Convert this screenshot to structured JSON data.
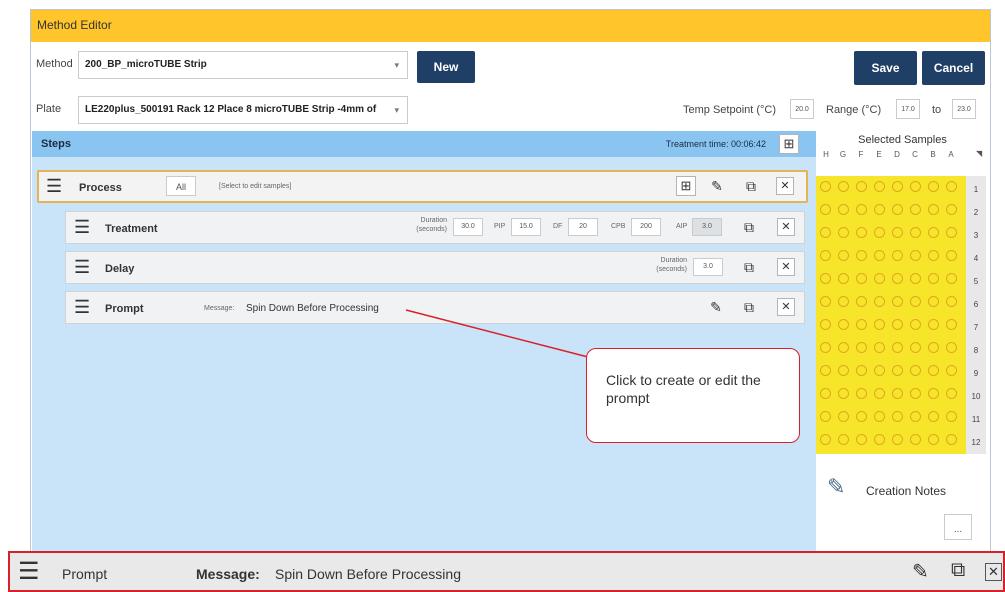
{
  "window": {
    "title": "Method Editor"
  },
  "method": {
    "label": "Method",
    "value": "200_BP_microTUBE Strip",
    "new_label": "New"
  },
  "actions": {
    "save_label": "Save",
    "cancel_label": "Cancel"
  },
  "plate": {
    "label": "Plate",
    "value": "LE220plus_500191 Rack 12 Place 8 microTUBE Strip -4mm of"
  },
  "temperature": {
    "setpoint_label": "Temp Setpoint (°C)",
    "setpoint_value": "20.0",
    "range_label": "Range (°C)",
    "range_low": "17.0",
    "range_to": "to",
    "range_high": "23.0"
  },
  "steps": {
    "header": "Steps",
    "treatment_time": "Treatment time: 00:06:42",
    "process": {
      "name": "Process",
      "all_label": "All",
      "hint": "[Select to edit samples]"
    },
    "treatment": {
      "name": "Treatment",
      "duration_label": "Duration (seconds)",
      "duration": "30.0",
      "pip_label": "PIP",
      "pip": "15.0",
      "df_label": "DF",
      "df": "20",
      "cpb_label": "CPB",
      "cpb": "200",
      "aip_label": "AIP",
      "aip": "3.0"
    },
    "delay": {
      "name": "Delay",
      "duration_label": "Duration (seconds)",
      "duration": "3.0"
    },
    "prompt": {
      "name": "Prompt",
      "message_label": "Message:",
      "message": "Spin Down Before Processing"
    }
  },
  "samples": {
    "title": "Selected Samples",
    "columns": [
      "H",
      "G",
      "F",
      "E",
      "D",
      "C",
      "B",
      "A"
    ],
    "rows": [
      "1",
      "2",
      "3",
      "4",
      "5",
      "6",
      "7",
      "8",
      "9",
      "10",
      "11",
      "12"
    ],
    "well_color": "#f7e52a"
  },
  "notes": {
    "label": "Creation Notes",
    "more_label": "..."
  },
  "callout": {
    "text": "Click to create or edit the prompt"
  },
  "zoom": {
    "name": "Prompt",
    "message_label": "Message:",
    "message": "Spin Down Before Processing"
  },
  "icons": [
    "menu-icon",
    "add-icon",
    "edit-icon",
    "copy-icon",
    "delete-icon",
    "notes-icon"
  ]
}
